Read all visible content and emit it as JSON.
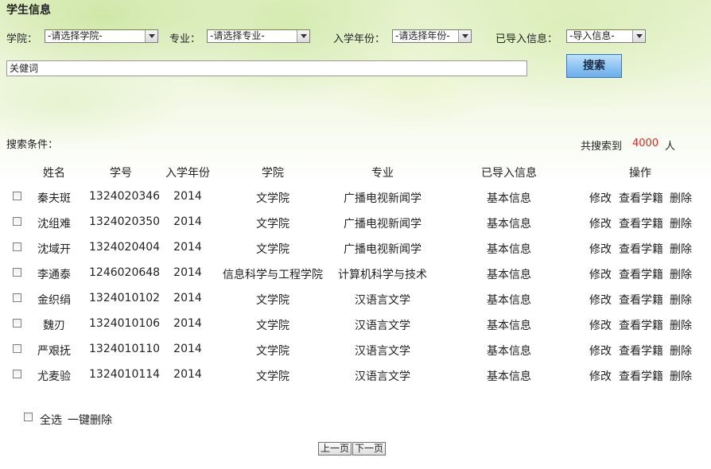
{
  "page_title": "学生信息",
  "filters": {
    "college_label": "学院：",
    "college_value": "-请选择学院-",
    "major_label": "专业：",
    "major_value": "-请选择专业-",
    "year_label": "入学年份：",
    "year_value": "-请选择年份-",
    "imported_label": "已导入信息：",
    "imported_value": "-导入信息-",
    "keyword_value": "关健词",
    "search_button": "搜索"
  },
  "summary": {
    "conditions_label": "搜索条件：",
    "result_prefix": "共搜索到",
    "result_count": "4000",
    "result_suffix": "人"
  },
  "colors": {
    "count": "#e0251b",
    "search_button": "#8cc4f2"
  },
  "table": {
    "headers": [
      "姓名",
      "学号",
      "入学年份",
      "学院",
      "专业",
      "已导入信息",
      "操作"
    ],
    "rows": [
      {
        "name": "秦夫斑",
        "id": "1324020346",
        "year": "2014",
        "college": "文学院",
        "major": "广播电视新闻学",
        "info": "基本信息"
      },
      {
        "name": "沈组难",
        "id": "1324020350",
        "year": "2014",
        "college": "文学院",
        "major": "广播电视新闻学",
        "info": "基本信息"
      },
      {
        "name": "沈域开",
        "id": "1324020404",
        "year": "2014",
        "college": "文学院",
        "major": "广播电视新闻学",
        "info": "基本信息"
      },
      {
        "name": "李通泰",
        "id": "1246020648",
        "year": "2014",
        "college": "信息科学与工程学院",
        "major": "计算机科学与技术",
        "info": "基本信息"
      },
      {
        "name": "金织绢",
        "id": "1324010102",
        "year": "2014",
        "college": "文学院",
        "major": "汉语言文学",
        "info": "基本信息"
      },
      {
        "name": "魏刃",
        "id": "1324010106",
        "year": "2014",
        "college": "文学院",
        "major": "汉语言文学",
        "info": "基本信息"
      },
      {
        "name": "严艰抚",
        "id": "1324010110",
        "year": "2014",
        "college": "文学院",
        "major": "汉语言文学",
        "info": "基本信息"
      },
      {
        "name": "尤麦验",
        "id": "1324010114",
        "year": "2014",
        "college": "文学院",
        "major": "汉语言文学",
        "info": "基本信息"
      }
    ],
    "actions": {
      "edit": "修改",
      "view": "查看学籍",
      "delete": "删除"
    }
  },
  "bulk": {
    "select_all": "全选",
    "delete_all": "一键删除"
  },
  "pagination": {
    "prev": "上一页",
    "next": "下一页"
  }
}
